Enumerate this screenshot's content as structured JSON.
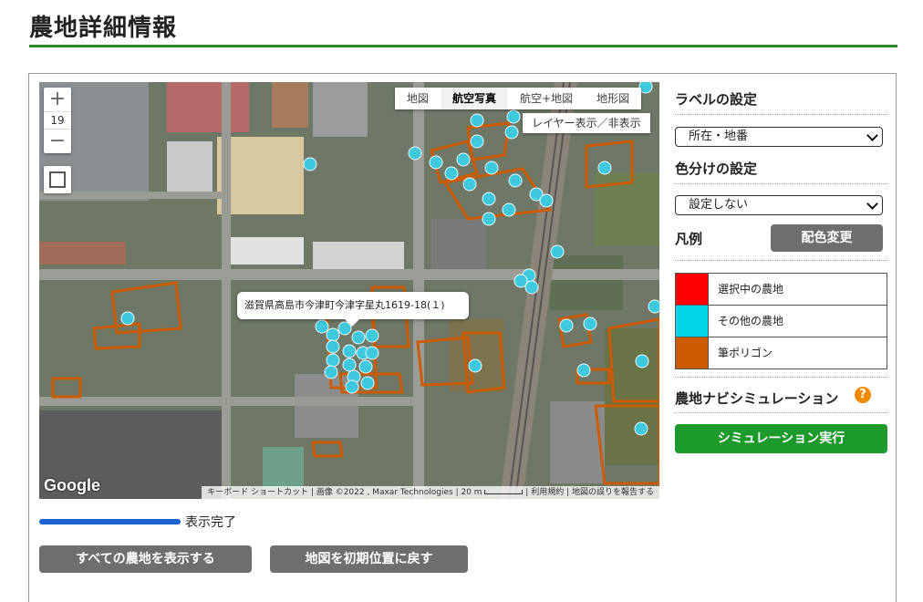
{
  "page": {
    "title": "農地詳細情報"
  },
  "map": {
    "zoom_in_label": "+",
    "zoom_level": "19",
    "zoom_out_label": "−",
    "map_types": [
      {
        "label": "地図",
        "active": false
      },
      {
        "label": "航空写真",
        "active": true
      },
      {
        "label": "航空+地図",
        "active": false
      },
      {
        "label": "地形図",
        "active": false
      }
    ],
    "layer_toggle_label": "レイヤー表示／非表示",
    "selected_address": "滋賀県高島市今津町今津字星丸1619-18(１)",
    "google_logo": "Google",
    "attribution": {
      "shortcuts": "キーボード ショートカット",
      "imagery": "画像 ©2022 , Maxar Technologies",
      "scale": "20 m",
      "terms": "利用規約",
      "report": "地図の誤りを報告する"
    }
  },
  "sidebar": {
    "label_heading": "ラベルの設定",
    "label_select_value": "所在・地番",
    "color_heading": "色分けの設定",
    "color_select_value": "設定しない",
    "legend_heading": "凡例",
    "recolor_button": "配色変更",
    "legend": [
      {
        "label": "選択中の農地",
        "color": "#ff0000"
      },
      {
        "label": "その他の農地",
        "color": "#00d4e6"
      },
      {
        "label": "筆ポリゴン",
        "color": "#cc5a00"
      }
    ],
    "simulation_heading": "農地ナビシミュレーション",
    "help_icon": "?",
    "simulation_button": "シミュレーション実行"
  },
  "status": {
    "progress": 1.0,
    "text": "表示完了"
  },
  "buttons": {
    "show_all": "すべての農地を表示する",
    "reset_map": "地図を初期位置に戻す"
  },
  "colors": {
    "accent_green": "#2a8a2a",
    "polygon": "#cc5a00",
    "marker": "#3fc9de",
    "progress_blue": "#1e63d6"
  }
}
